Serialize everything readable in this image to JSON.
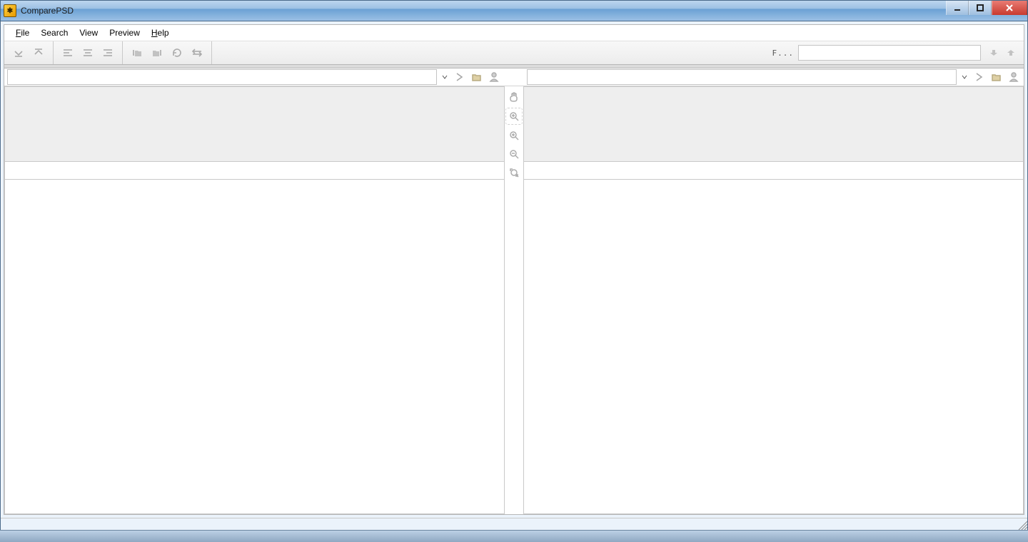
{
  "window": {
    "title": "ComparePSD"
  },
  "menu": {
    "file": "File",
    "search": "Search",
    "view": "View",
    "preview": "Preview",
    "help": "Help"
  },
  "toolbar": {
    "filter_label": "F...",
    "filter_value": ""
  },
  "paths": {
    "left": "",
    "right": ""
  }
}
